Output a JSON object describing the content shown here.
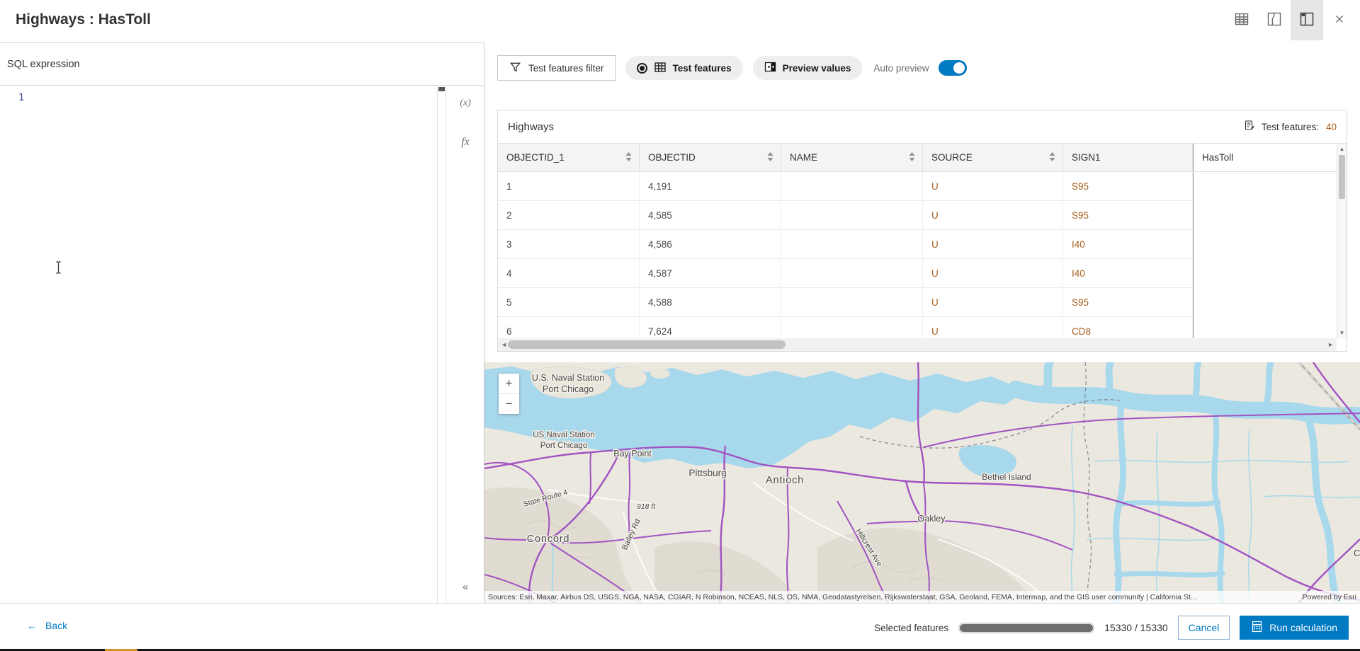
{
  "header": {
    "title": "Highways : HasToll",
    "close_glyph": "×"
  },
  "left_panel": {
    "section_label": "SQL expression",
    "line_number": "1",
    "variables_tool": "(x)",
    "functions_tool": "fx",
    "collapse_glyph": "«"
  },
  "toolbar": {
    "filter_label": "Test features filter",
    "test_features_label": "Test features",
    "preview_values_label": "Preview values",
    "auto_preview_label": "Auto preview",
    "auto_preview_on": true
  },
  "table": {
    "title": "Highways",
    "test_features_caption": "Test features:",
    "test_features_count": "40",
    "columns": [
      "OBJECTID_1",
      "OBJECTID",
      "NAME",
      "SOURCE",
      "SIGN1",
      "HasToll"
    ],
    "rows": [
      [
        "1",
        "4,191",
        "",
        "U",
        "S95",
        ""
      ],
      [
        "2",
        "4,585",
        "",
        "U",
        "S95",
        ""
      ],
      [
        "3",
        "4,586",
        "",
        "U",
        "I40",
        ""
      ],
      [
        "4",
        "4,587",
        "",
        "U",
        "I40",
        ""
      ],
      [
        "5",
        "4,588",
        "",
        "U",
        "S95",
        ""
      ],
      [
        "6",
        "7,624",
        "",
        "U",
        "CD8",
        ""
      ]
    ]
  },
  "map": {
    "zoom_in": "+",
    "zoom_out": "−",
    "labels": {
      "naval1a": "U.S. Naval Station",
      "naval1b": "Port Chicago",
      "naval2a": "US Naval Station",
      "naval2b": "Port Chicago",
      "bay_point": "Bay Point",
      "pittsburg": "Pittsburg",
      "antioch": "Antioch",
      "bethel_island": "Bethel Island",
      "oakley": "Oakley",
      "concord": "Concord",
      "elevation": "918 ft",
      "hillcrest": "Hillcrest Ave",
      "bailey": "Bailey Rd",
      "state_route": "State Route 4",
      "partial_city": "C"
    },
    "attribution": "Sources: Esri, Maxar, Airbus DS, USGS, NGA, NASA, CGIAR, N Robinson, NCEAS, NLS, OS, NMA, Geodatastyrelsen, Rijkswaterstaat, GSA, Geoland, FEMA, Intermap, and the GIS user community | California St...",
    "powered_by": "Powered by Esri"
  },
  "footer": {
    "back_label": "Back",
    "back_arrow": "←",
    "selected_label": "Selected features",
    "count_text": "15330 / 15330",
    "progress_pct": 100,
    "cancel_label": "Cancel",
    "run_label": "Run calculation"
  },
  "colors": {
    "accent_blue": "#007ac2",
    "string_value_orange": "#a8611f",
    "road_purple": "#a153c1",
    "water_blue": "#a8d8ec",
    "progress_fill": "#6e6e6e"
  }
}
